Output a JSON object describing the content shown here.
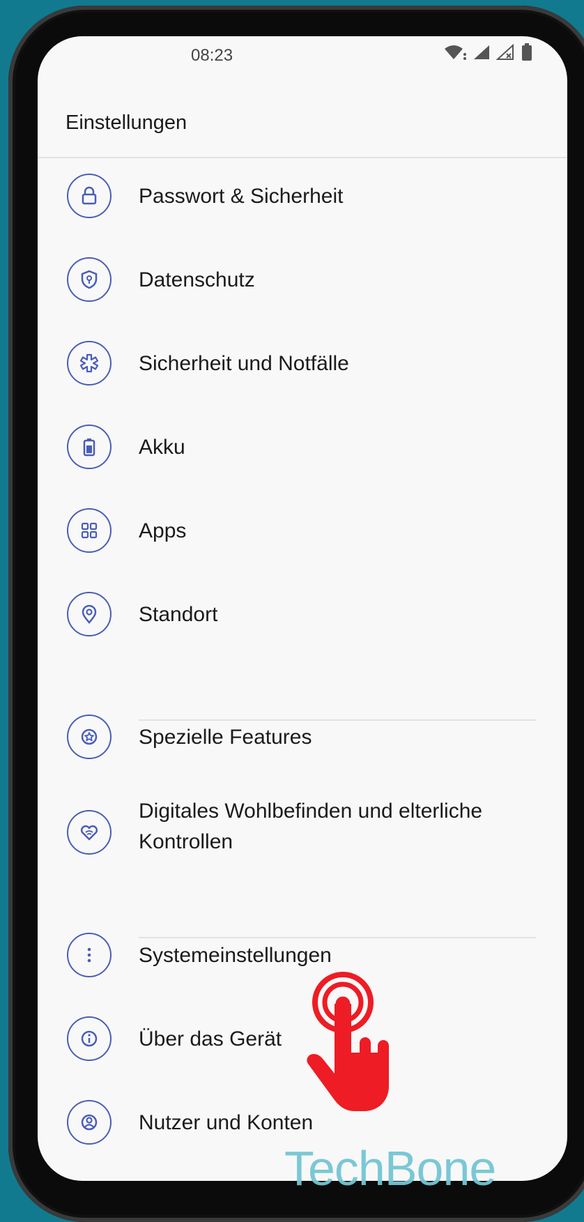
{
  "status_bar": {
    "time": "08:23"
  },
  "title": "Einstellungen",
  "items": [
    {
      "label": "Passwort & Sicherheit",
      "icon": "lock-icon"
    },
    {
      "label": "Datenschutz",
      "icon": "shield-key-icon"
    },
    {
      "label": "Sicherheit und Notfälle",
      "icon": "medical-star-icon"
    },
    {
      "label": "Akku",
      "icon": "battery-icon"
    },
    {
      "label": "Apps",
      "icon": "apps-grid-icon"
    },
    {
      "label": "Standort",
      "icon": "location-pin-icon"
    },
    {
      "label": "Spezielle Features",
      "icon": "star-badge-icon"
    },
    {
      "label": "Digitales Wohlbefinden und elterliche Kontrollen",
      "icon": "heart-icon"
    },
    {
      "label": "Systemeinstellungen",
      "icon": "more-vertical-icon"
    },
    {
      "label": "Über das Gerät",
      "icon": "info-icon"
    },
    {
      "label": "Nutzer und Konten",
      "icon": "user-circle-icon"
    }
  ],
  "watermark": "TechBone",
  "colors": {
    "accent": "#4a5db8",
    "background": "#127a8f",
    "screen": "#f8f8f8",
    "tap_indicator": "#ee1c24"
  }
}
